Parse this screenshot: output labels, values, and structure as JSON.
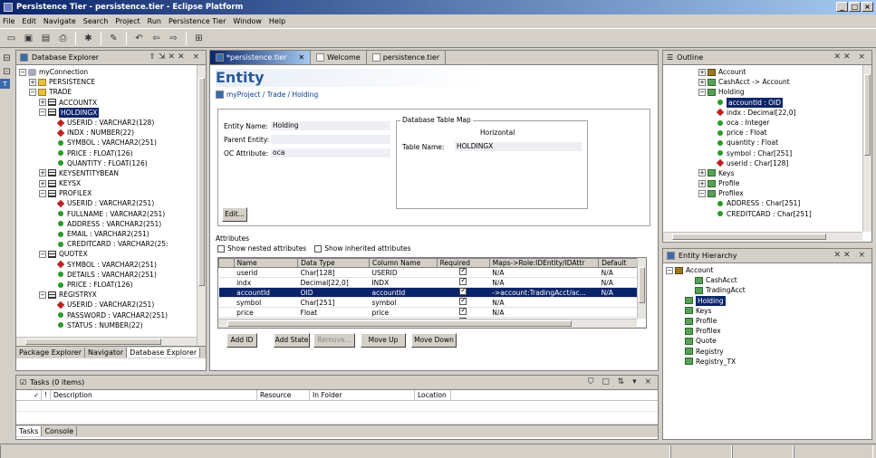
{
  "window": {
    "title": "Persistence Tier - persistence.tier - Eclipse Platform",
    "min": "_",
    "max": "□",
    "close": "×"
  },
  "menu": [
    "File",
    "Edit",
    "Navigate",
    "Search",
    "Project",
    "Run",
    "Persistence Tier",
    "Window",
    "Help"
  ],
  "db_explorer": {
    "title": "Database Explorer",
    "tree": [
      {
        "label": "myConnection",
        "icon": "db",
        "indent": 0,
        "exp": "−"
      },
      {
        "label": "PERSISTENCE",
        "icon": "folder",
        "indent": 1,
        "exp": "+"
      },
      {
        "label": "TRADE",
        "icon": "folder",
        "indent": 1,
        "exp": "−"
      },
      {
        "label": "ACCOUNTX",
        "icon": "table",
        "indent": 2,
        "exp": "+"
      },
      {
        "label": "HOLDINGX",
        "icon": "table",
        "indent": 2,
        "exp": "−",
        "selected": true
      },
      {
        "label": "USERID : VARCHAR2(128)",
        "icon": "key",
        "indent": 3
      },
      {
        "label": "INDX : NUMBER(22)",
        "icon": "key",
        "indent": 3
      },
      {
        "label": "SYMBOL : VARCHAR2(251)",
        "icon": "col",
        "indent": 3
      },
      {
        "label": "PRICE : FLOAT(126)",
        "icon": "col",
        "indent": 3
      },
      {
        "label": "QUANTITY : FLOAT(126)",
        "icon": "col",
        "indent": 3
      },
      {
        "label": "KEYSENTITYBEAN",
        "icon": "table",
        "indent": 2,
        "exp": "+"
      },
      {
        "label": "KEYSX",
        "icon": "table",
        "indent": 2,
        "exp": "+"
      },
      {
        "label": "PROFILEX",
        "icon": "table",
        "indent": 2,
        "exp": "−"
      },
      {
        "label": "USERID : VARCHAR2(251)",
        "icon": "key",
        "indent": 3
      },
      {
        "label": "FULLNAME : VARCHAR2(251)",
        "icon": "col",
        "indent": 3
      },
      {
        "label": "ADDRESS : VARCHAR2(251)",
        "icon": "col",
        "indent": 3
      },
      {
        "label": "EMAIL : VARCHAR2(251)",
        "icon": "col",
        "indent": 3
      },
      {
        "label": "CREDITCARD : VARCHAR2(25:",
        "icon": "col",
        "indent": 3
      },
      {
        "label": "QUOTEX",
        "icon": "table",
        "indent": 2,
        "exp": "−"
      },
      {
        "label": "SYMBOL : VARCHAR2(251)",
        "icon": "key",
        "indent": 3
      },
      {
        "label": "DETAILS : VARCHAR2(251)",
        "icon": "col",
        "indent": 3
      },
      {
        "label": "PRICE : FLOAT(126)",
        "icon": "col",
        "indent": 3
      },
      {
        "label": "REGISTRYX",
        "icon": "table",
        "indent": 2,
        "exp": "−"
      },
      {
        "label": "USERID : VARCHAR2(251)",
        "icon": "key",
        "indent": 3
      },
      {
        "label": "PASSWORD : VARCHAR2(251)",
        "icon": "col",
        "indent": 3
      },
      {
        "label": "STATUS : NUMBER(22)",
        "icon": "col",
        "indent": 3
      }
    ],
    "bottom_tabs": [
      "Package Explorer",
      "Navigator",
      "Database Explorer"
    ]
  },
  "editor": {
    "tabs": [
      "*persistence.tier",
      "Welcome",
      "persistence.tier"
    ],
    "heading": "Entity",
    "breadcrumb": "myProject / Trade / Holding",
    "entity_name_label": "Entity Name:",
    "entity_name": "Holding",
    "parent_entity_label": "Parent Entity:",
    "parent_entity": "",
    "oc_attr_label": "OC Attribute:",
    "oc_attr": "oca",
    "db_map_label": "Database Table Map",
    "map_mode": "Horizontal",
    "table_name_label": "Table Name:",
    "table_name": "HOLDINGX",
    "edit_btn": "Edit...",
    "attributes_label": "Attributes",
    "show_nested": "Show nested attributes",
    "show_inherited": "Show inherited attributes",
    "columns": [
      "Name",
      "Data Type",
      "Column Name",
      "Required",
      "Maps->Role:IDEntity/IDAttr",
      "Default"
    ],
    "rows": [
      {
        "icon": "key",
        "name": "userid",
        "type": "Char[128]",
        "col": "USERID",
        "req": true,
        "maps": "N/A",
        "def": "N/A"
      },
      {
        "icon": "key",
        "name": "indx",
        "type": "Decimal[22,0]",
        "col": "INDX",
        "req": true,
        "maps": "N/A",
        "def": "N/A"
      },
      {
        "icon": "ref",
        "name": "accountId",
        "type": "OID",
        "col": "accountId",
        "req": true,
        "maps": "->account:TradingAcct/ac...",
        "def": "N/A",
        "sel": true
      },
      {
        "icon": "col",
        "name": "symbol",
        "type": "Char[251]",
        "col": "symbol",
        "req": true,
        "maps": "N/A",
        "def": ""
      },
      {
        "icon": "col",
        "name": "price",
        "type": "Float",
        "col": "price",
        "req": true,
        "maps": "N/A",
        "def": ""
      },
      {
        "icon": "col",
        "name": "quantity",
        "type": "Float",
        "col": "quantity",
        "req": true,
        "maps": "N/A",
        "def": ""
      }
    ],
    "buttons": [
      "Add ID",
      "Add State",
      "Remove...",
      "Move Up",
      "Move Down"
    ]
  },
  "outline": {
    "title": "Outline",
    "tree": [
      {
        "label": "Account",
        "indent": 1,
        "exp": "+",
        "icon": "ent2"
      },
      {
        "label": "CashAcct -> Account",
        "indent": 1,
        "exp": "+",
        "icon": "ent"
      },
      {
        "label": "Holding",
        "indent": 1,
        "exp": "−",
        "icon": "ent"
      },
      {
        "label": "accountId : OID",
        "indent": 2,
        "icon": "col",
        "selected": true
      },
      {
        "label": "indx : Decimal[22,0]",
        "indent": 2,
        "icon": "key"
      },
      {
        "label": "oca : Integer",
        "indent": 2,
        "icon": "col"
      },
      {
        "label": "price : Float",
        "indent": 2,
        "icon": "col"
      },
      {
        "label": "quantity : Float",
        "indent": 2,
        "icon": "col"
      },
      {
        "label": "symbol : Char[251]",
        "indent": 2,
        "icon": "col"
      },
      {
        "label": "userid : Char[128]",
        "indent": 2,
        "icon": "key"
      },
      {
        "label": "Keys",
        "indent": 1,
        "exp": "+",
        "icon": "ent"
      },
      {
        "label": "Profile",
        "indent": 1,
        "exp": "+",
        "icon": "ent"
      },
      {
        "label": "Profilex",
        "indent": 1,
        "exp": "−",
        "icon": "ent"
      },
      {
        "label": "ADDRESS : Char[251]",
        "indent": 2,
        "icon": "col"
      },
      {
        "label": "CREDITCARD : Char[251]",
        "indent": 2,
        "icon": "col"
      }
    ]
  },
  "hierarchy": {
    "title": "Entity Hierarchy",
    "tree": [
      {
        "label": "Account",
        "indent": 0,
        "exp": "−",
        "icon": "ent2"
      },
      {
        "label": "CashAcct",
        "indent": 2,
        "icon": "ent"
      },
      {
        "label": "TradingAcct",
        "indent": 2,
        "icon": "ent"
      },
      {
        "label": "Holding",
        "indent": 1,
        "icon": "ent",
        "selected": true
      },
      {
        "label": "Keys",
        "indent": 1,
        "icon": "ent"
      },
      {
        "label": "Profile",
        "indent": 1,
        "icon": "ent"
      },
      {
        "label": "Profilex",
        "indent": 1,
        "icon": "ent"
      },
      {
        "label": "Quote",
        "indent": 1,
        "icon": "ent"
      },
      {
        "label": "Registry",
        "indent": 1,
        "icon": "ent"
      },
      {
        "label": "Registry_TX",
        "indent": 1,
        "icon": "ent"
      }
    ]
  },
  "tasks": {
    "title": "Tasks (0 items)",
    "columns": [
      "✓",
      "!",
      "Description",
      "Resource",
      "In Folder",
      "Location"
    ],
    "bottom_tabs": [
      "Tasks",
      "Console"
    ]
  },
  "colors": {
    "selection": "#0a246a",
    "chrome": "#d4d0c8"
  }
}
